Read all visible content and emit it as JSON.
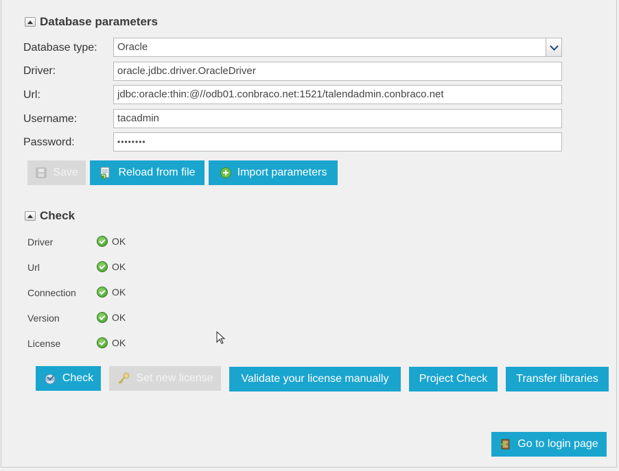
{
  "db_section": {
    "title": "Database parameters",
    "labels": {
      "type": "Database type:",
      "driver": "Driver:",
      "url": "Url:",
      "username": "Username:",
      "password": "Password:"
    },
    "values": {
      "type": "Oracle",
      "driver": "oracle.jdbc.driver.OracleDriver",
      "url": "jdbc:oracle:thin:@//odb01.conbraco.net:1521/talendadmin.conbraco.net",
      "username": "tacadmin",
      "password": "••••••••"
    },
    "buttons": {
      "save": "Save",
      "reload": "Reload from file",
      "import": "Import parameters"
    }
  },
  "check_section": {
    "title": "Check",
    "items": [
      {
        "label": "Driver",
        "status": "OK"
      },
      {
        "label": "Url",
        "status": "OK"
      },
      {
        "label": "Connection",
        "status": "OK"
      },
      {
        "label": "Version",
        "status": "OK"
      },
      {
        "label": "License",
        "status": "OK"
      }
    ],
    "buttons": {
      "check": "Check",
      "set_license": "Set new license",
      "validate": "Validate your license manually",
      "project_check": "Project Check",
      "transfer": "Transfer libraries"
    }
  },
  "login_button": "Go to login page",
  "icons": {
    "collapse": "collapse-up-icon",
    "select": "chevron-down-icon",
    "save": "save-icon",
    "reload": "reload-file-icon",
    "import": "add-circle-icon",
    "ok": "check-ok-icon",
    "check": "check-tool-icon",
    "key": "key-icon",
    "login": "door-icon"
  },
  "colors": {
    "button": "#1aa5cf",
    "button_disabled": "#d9d9d9",
    "ok": "#3f9a2a"
  }
}
